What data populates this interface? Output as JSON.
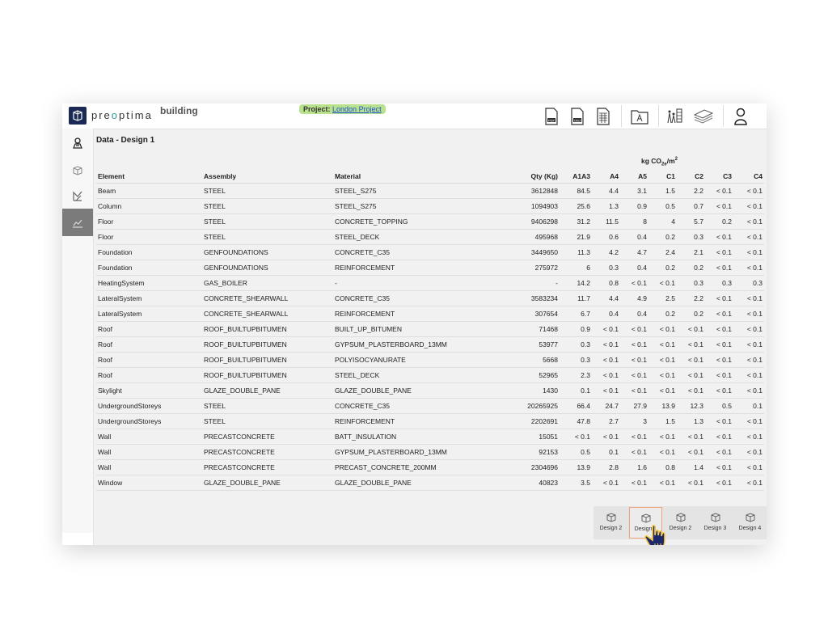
{
  "header": {
    "logo_text": "preoptima",
    "product_name": "building",
    "project_label": "Project:",
    "project_name": "London Project",
    "icons": [
      "file-pdf-icon",
      "file-obj-icon",
      "file-xls-icon",
      "folder-icon",
      "analysis-icon",
      "layers-icon",
      "user-icon"
    ],
    "pdf_tag": "PDF",
    "obj_tag": "OBJ",
    "xls_tag": "XLS"
  },
  "sidebar": {
    "items": [
      "building-icon",
      "cube-icon",
      "design-icon",
      "chart-icon"
    ],
    "active_index": 3
  },
  "page": {
    "title": "Data - Design 1",
    "unit": {
      "base": "kg CO",
      "sub": "2e",
      "tail": "/m",
      "sup": "2"
    }
  },
  "table": {
    "columns": [
      "Element",
      "Assembly",
      "Material",
      "Qty (Kg)",
      "A1A3",
      "A4",
      "A5",
      "C1",
      "C2",
      "C3",
      "C4"
    ],
    "rows": [
      [
        "Beam",
        "STEEL",
        "STEEL_S275",
        "3612848",
        "84.5",
        "4.4",
        "3.1",
        "1.5",
        "2.2",
        "< 0.1",
        "< 0.1"
      ],
      [
        "Column",
        "STEEL",
        "STEEL_S275",
        "1094903",
        "25.6",
        "1.3",
        "0.9",
        "0.5",
        "0.7",
        "< 0.1",
        "< 0.1"
      ],
      [
        "Floor",
        "STEEL",
        "CONCRETE_TOPPING",
        "9406298",
        "31.2",
        "11.5",
        "8",
        "4",
        "5.7",
        "0.2",
        "< 0.1"
      ],
      [
        "Floor",
        "STEEL",
        "STEEL_DECK",
        "495968",
        "21.9",
        "0.6",
        "0.4",
        "0.2",
        "0.3",
        "< 0.1",
        "< 0.1"
      ],
      [
        "Foundation",
        "GENFOUNDATIONS",
        "CONCRETE_C35",
        "3449650",
        "11.3",
        "4.2",
        "4.7",
        "2.4",
        "2.1",
        "< 0.1",
        "< 0.1"
      ],
      [
        "Foundation",
        "GENFOUNDATIONS",
        "REINFORCEMENT",
        "275972",
        "6",
        "0.3",
        "0.4",
        "0.2",
        "0.2",
        "< 0.1",
        "< 0.1"
      ],
      [
        "HeatingSystem",
        "GAS_BOILER",
        "-",
        "-",
        "14.2",
        "0.8",
        "< 0.1",
        "< 0.1",
        "0.3",
        "0.3",
        "0.3"
      ],
      [
        "LateralSystem",
        "CONCRETE_SHEARWALL",
        "CONCRETE_C35",
        "3583234",
        "11.7",
        "4.4",
        "4.9",
        "2.5",
        "2.2",
        "< 0.1",
        "< 0.1"
      ],
      [
        "LateralSystem",
        "CONCRETE_SHEARWALL",
        "REINFORCEMENT",
        "307654",
        "6.7",
        "0.4",
        "0.4",
        "0.2",
        "0.2",
        "< 0.1",
        "< 0.1"
      ],
      [
        "Roof",
        "ROOF_BUILTUPBITUMEN",
        "BUILT_UP_BITUMEN",
        "71468",
        "0.9",
        "< 0.1",
        "< 0.1",
        "< 0.1",
        "< 0.1",
        "< 0.1",
        "< 0.1"
      ],
      [
        "Roof",
        "ROOF_BUILTUPBITUMEN",
        "GYPSUM_PLASTERBOARD_13MM",
        "53977",
        "0.3",
        "< 0.1",
        "< 0.1",
        "< 0.1",
        "< 0.1",
        "< 0.1",
        "< 0.1"
      ],
      [
        "Roof",
        "ROOF_BUILTUPBITUMEN",
        "POLYISOCYANURATE",
        "5668",
        "0.3",
        "< 0.1",
        "< 0.1",
        "< 0.1",
        "< 0.1",
        "< 0.1",
        "< 0.1"
      ],
      [
        "Roof",
        "ROOF_BUILTUPBITUMEN",
        "STEEL_DECK",
        "52965",
        "2.3",
        "< 0.1",
        "< 0.1",
        "< 0.1",
        "< 0.1",
        "< 0.1",
        "< 0.1"
      ],
      [
        "Skylight",
        "GLAZE_DOUBLE_PANE",
        "GLAZE_DOUBLE_PANE",
        "1430",
        "0.1",
        "< 0.1",
        "< 0.1",
        "< 0.1",
        "< 0.1",
        "< 0.1",
        "< 0.1"
      ],
      [
        "UndergroundStoreys",
        "STEEL",
        "CONCRETE_C35",
        "20265925",
        "66.4",
        "24.7",
        "27.9",
        "13.9",
        "12.3",
        "0.5",
        "0.1"
      ],
      [
        "UndergroundStoreys",
        "STEEL",
        "REINFORCEMENT",
        "2202691",
        "47.8",
        "2.7",
        "3",
        "1.5",
        "1.3",
        "< 0.1",
        "< 0.1"
      ],
      [
        "Wall",
        "PRECASTCONCRETE",
        "BATT_INSULATION",
        "15051",
        "< 0.1",
        "< 0.1",
        "< 0.1",
        "< 0.1",
        "< 0.1",
        "< 0.1",
        "< 0.1"
      ],
      [
        "Wall",
        "PRECASTCONCRETE",
        "GYPSUM_PLASTERBOARD_13MM",
        "92153",
        "0.5",
        "0.1",
        "< 0.1",
        "< 0.1",
        "< 0.1",
        "< 0.1",
        "< 0.1"
      ],
      [
        "Wall",
        "PRECASTCONCRETE",
        "PRECAST_CONCRETE_200MM",
        "2304696",
        "13.9",
        "2.8",
        "1.6",
        "0.8",
        "1.4",
        "< 0.1",
        "< 0.1"
      ],
      [
        "Window",
        "GLAZE_DOUBLE_PANE",
        "GLAZE_DOUBLE_PANE",
        "40823",
        "3.5",
        "< 0.1",
        "< 0.1",
        "< 0.1",
        "< 0.1",
        "< 0.1",
        "< 0.1"
      ]
    ]
  },
  "design_bar": {
    "designs": [
      "Design 2",
      "Design 1",
      "Design 2",
      "Design 3",
      "Design 4"
    ],
    "active_index": 1
  },
  "colors": {
    "accent_green": "#b9e28f",
    "active_sidebar": "#7b7b7b",
    "active_design_border": "#f0a27a",
    "logo_navy": "#1b2a55",
    "cursor_navy": "#1c2a6b"
  }
}
